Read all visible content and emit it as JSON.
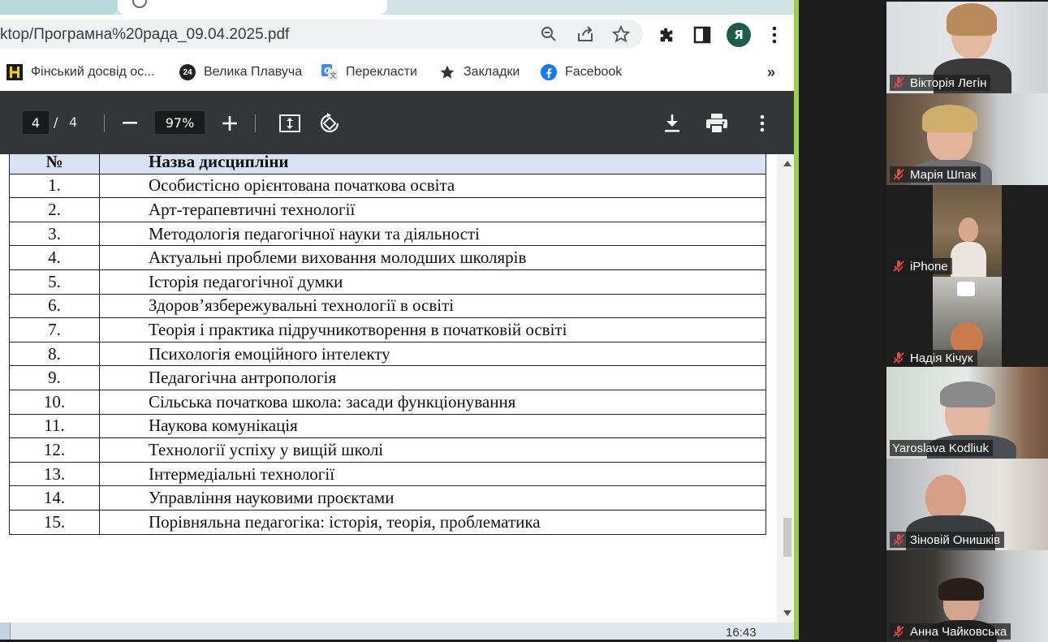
{
  "browser": {
    "address_bar": {
      "url": "ktop/Програмна%20рада_09.04.2025.pdf"
    },
    "avatar_letter": "Я",
    "bookmarks": [
      {
        "label": "Фінський досвід ос...",
        "icon": "book-icon"
      },
      {
        "label": "Велика Плавуча",
        "icon": "badge-24-icon"
      },
      {
        "label": "Перекласти",
        "icon": "translate-icon"
      },
      {
        "label": "Закладки",
        "icon": "star-icon"
      },
      {
        "label": "Facebook",
        "icon": "facebook-icon"
      }
    ],
    "bookmarks_overflow": "»",
    "badge_24": "24"
  },
  "pdf_toolbar": {
    "current_page": "4",
    "page_separator": "/",
    "total_pages": "4",
    "zoom": "97%"
  },
  "table": {
    "headers": [
      "№",
      "Назва дисципліни"
    ],
    "rows": [
      [
        "1.",
        "Особистісно орієнтована початкова освіта"
      ],
      [
        "2.",
        "Арт-терапевтичні технології"
      ],
      [
        "3.",
        "Методологія педагогічної науки та діяльності"
      ],
      [
        "4.",
        "Актуальні проблеми виховання молодших школярів"
      ],
      [
        "5.",
        "Історія педагогічної думки"
      ],
      [
        "6.",
        "Здоров’язбережувальні технології в освіті"
      ],
      [
        "7.",
        "Теорія і практика підручникотворення в початковій освіті"
      ],
      [
        "8.",
        "Психологія емоційного інтелекту"
      ],
      [
        "9.",
        "Педагогічна антропологія"
      ],
      [
        "10.",
        "Сільська початкова школа: засади функціонування"
      ],
      [
        "11.",
        "Наукова комунікація"
      ],
      [
        "12.",
        "Технології успіху у вищій школі"
      ],
      [
        "13.",
        "Інтермедіальні технології"
      ],
      [
        "14.",
        "Управління науковими проєктами"
      ],
      [
        "15.",
        "Порівняльна педагогіка: історія, теорія, проблематика"
      ]
    ]
  },
  "taskbar": {
    "clock": "16:43"
  },
  "participants": [
    {
      "name": "Вікторія Легін",
      "muted": true
    },
    {
      "name": "Марія Шпак",
      "muted": true
    },
    {
      "name": "iPhone",
      "muted": true
    },
    {
      "name": "Надія Кічук",
      "muted": true
    },
    {
      "name": "Yaroslava Kodliuk",
      "muted": false,
      "active_speaker": true
    },
    {
      "name": "Зіновій Онишків",
      "muted": true
    },
    {
      "name": "Анна Чайковська",
      "muted": true
    }
  ],
  "colors": {
    "pdf_toolbar_bg": "#323639",
    "active_speaker_outline": "#35c96a",
    "table_header_bg": "#d9e2f3",
    "muted_mic": "#e5484d",
    "separator_green": "#9bd14a"
  }
}
